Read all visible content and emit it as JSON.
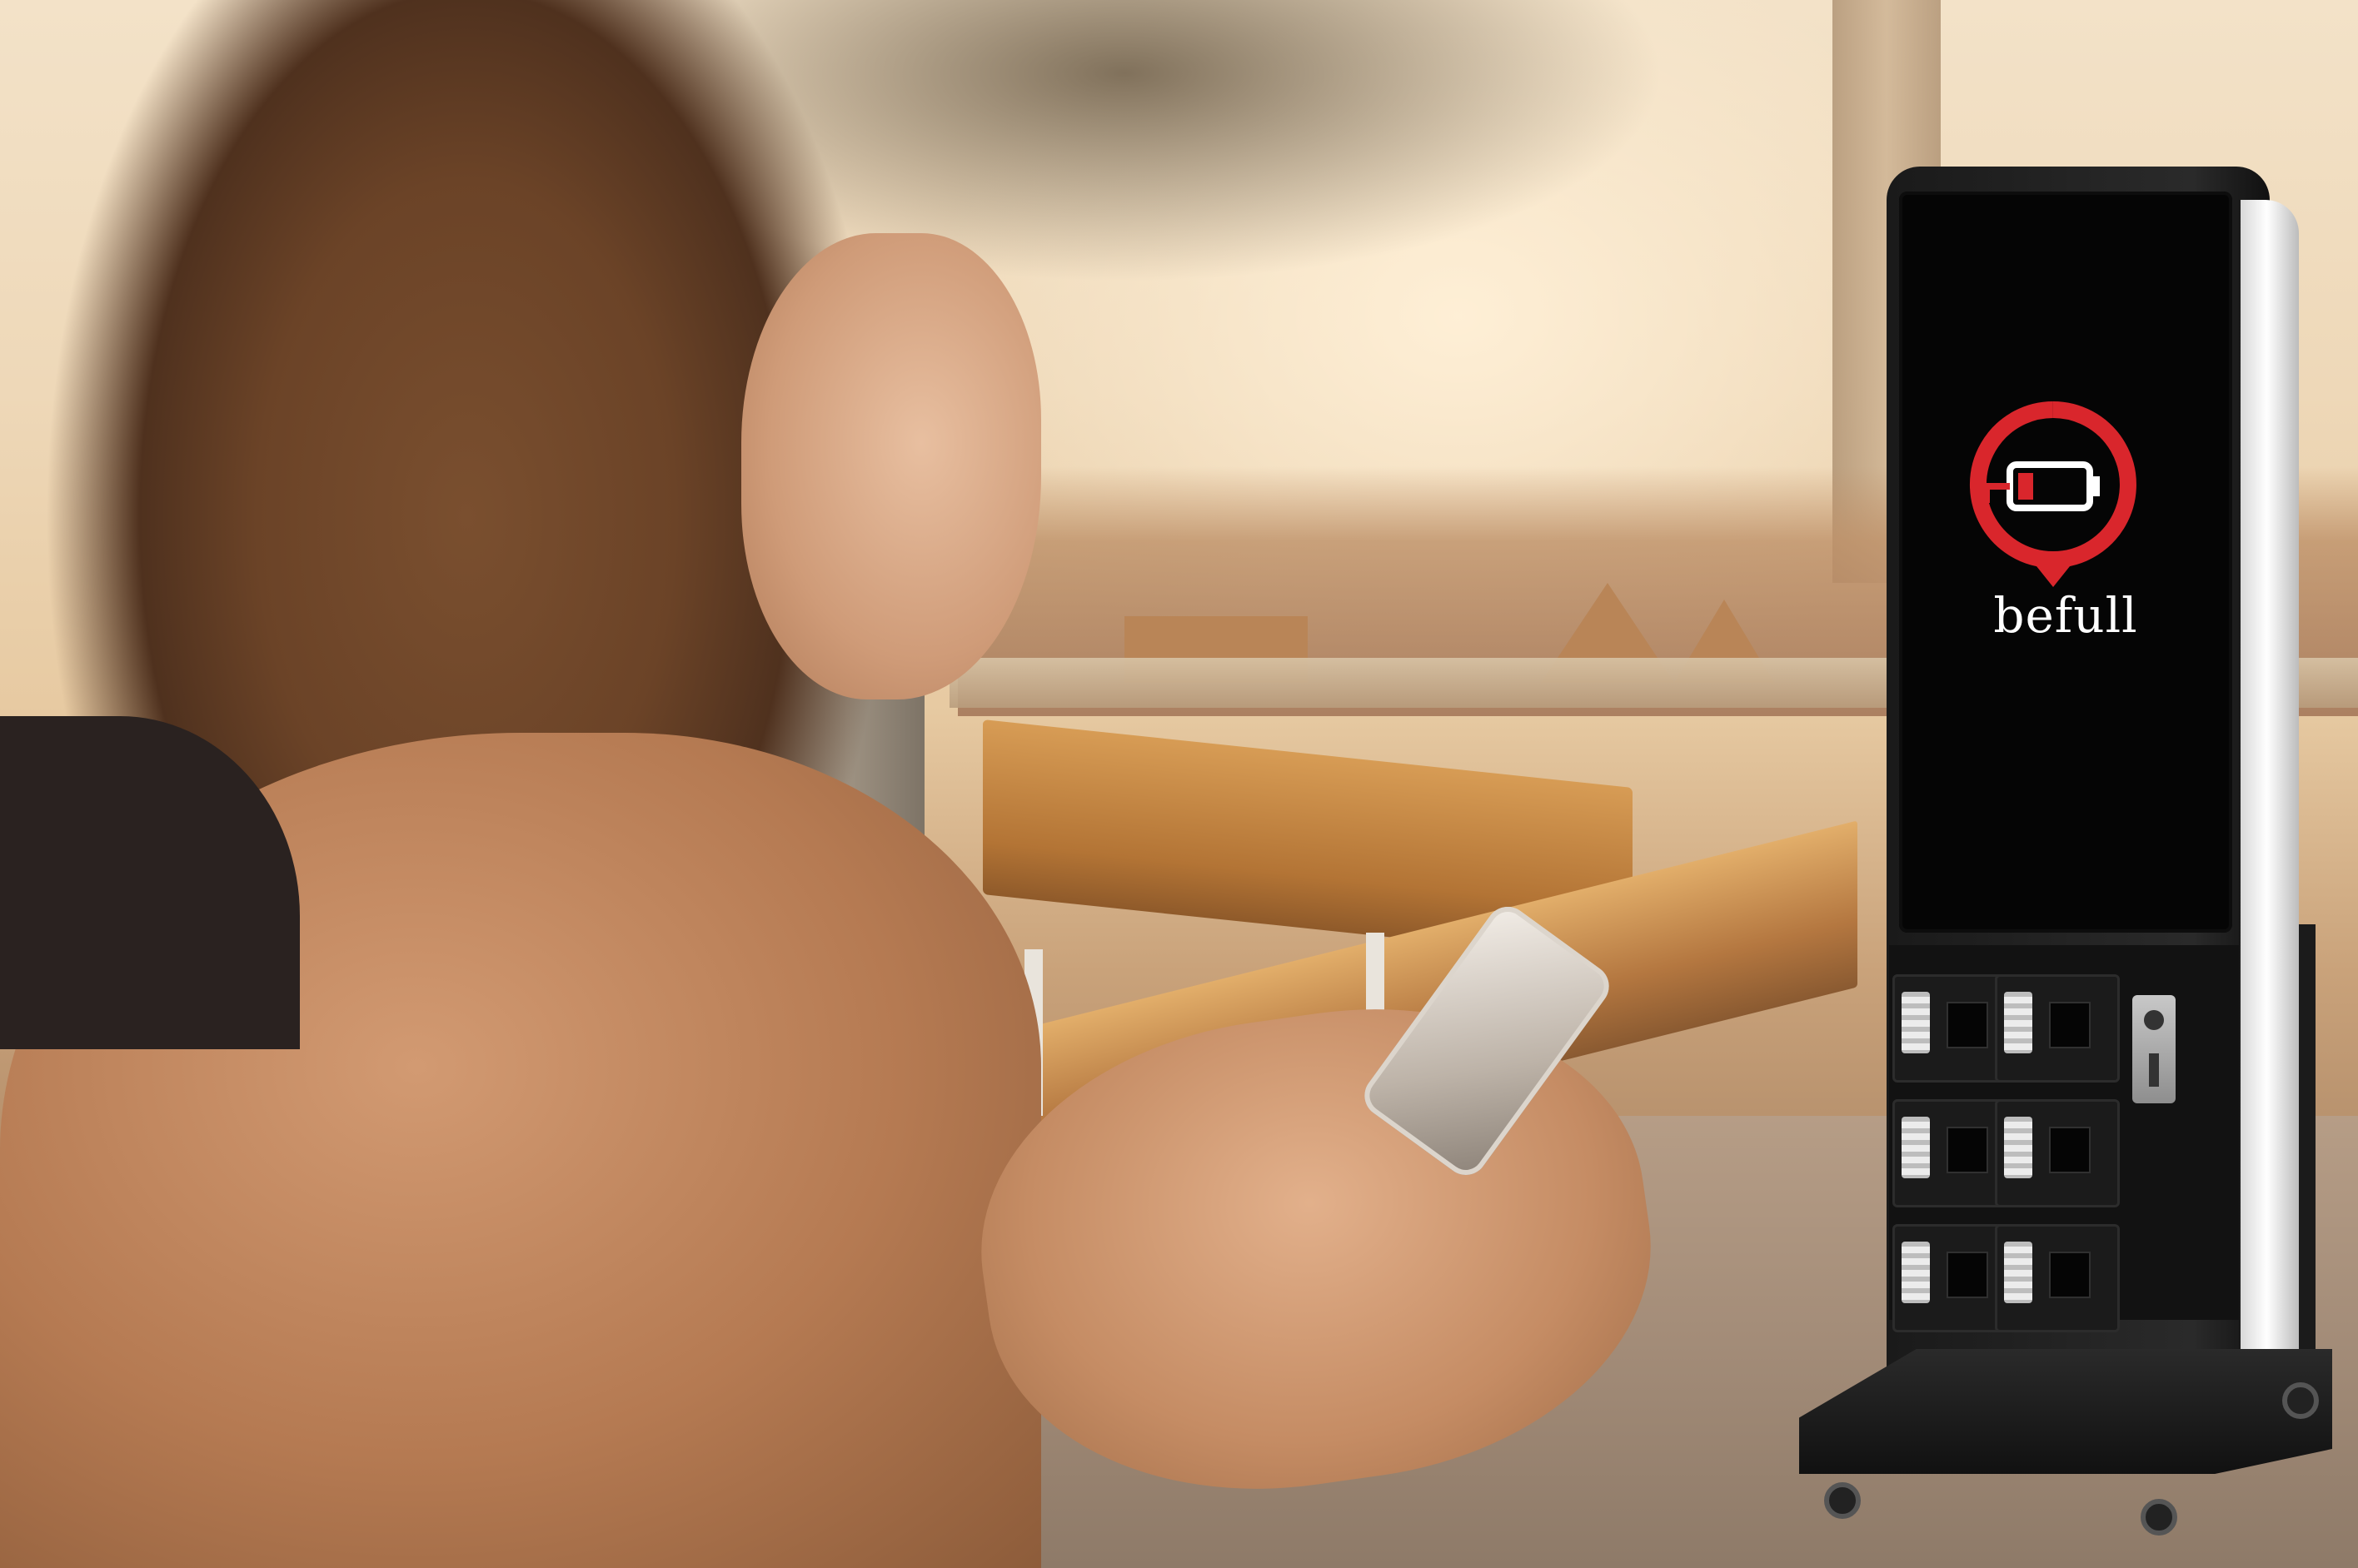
{
  "kiosk": {
    "brand_name": "befull",
    "logo_icon": "battery-low-location-pin-icon",
    "accent_color": "#d9262c",
    "locker_count": 6
  }
}
